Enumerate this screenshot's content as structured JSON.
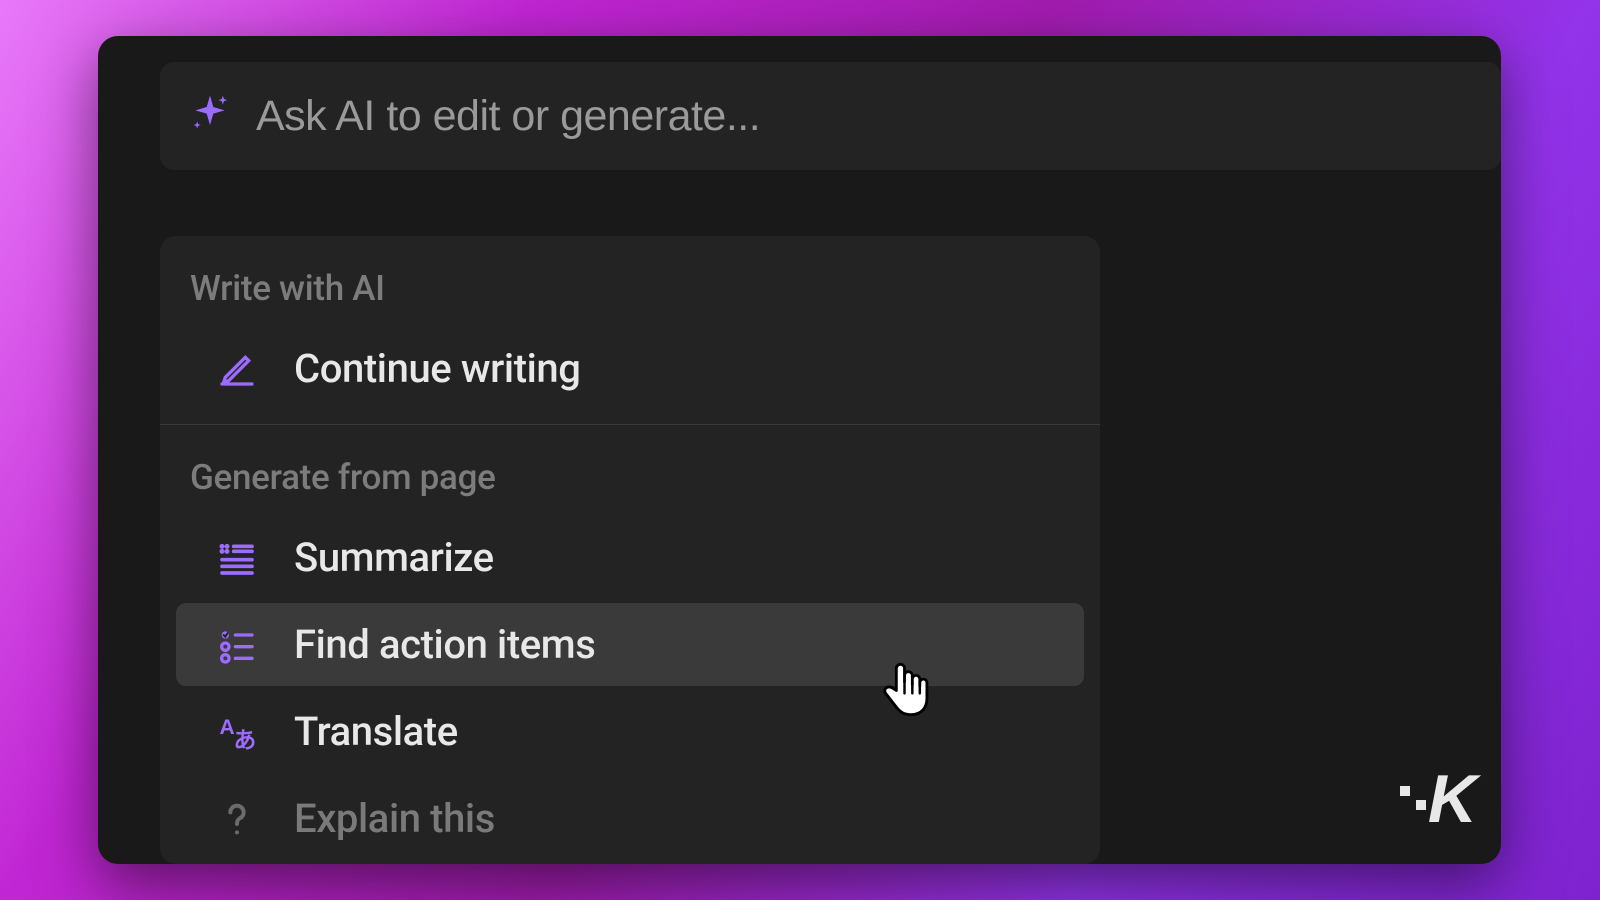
{
  "ask": {
    "placeholder": "Ask AI to edit or generate..."
  },
  "menu": {
    "section1": {
      "header": "Write with AI"
    },
    "section2": {
      "header": "Generate from page"
    },
    "items": {
      "continue_writing": "Continue writing",
      "summarize": "Summarize",
      "find_action_items": "Find action items",
      "translate": "Translate",
      "explain_this": "Explain this"
    }
  },
  "accent_color": "#9c6cff",
  "watermark": "K"
}
